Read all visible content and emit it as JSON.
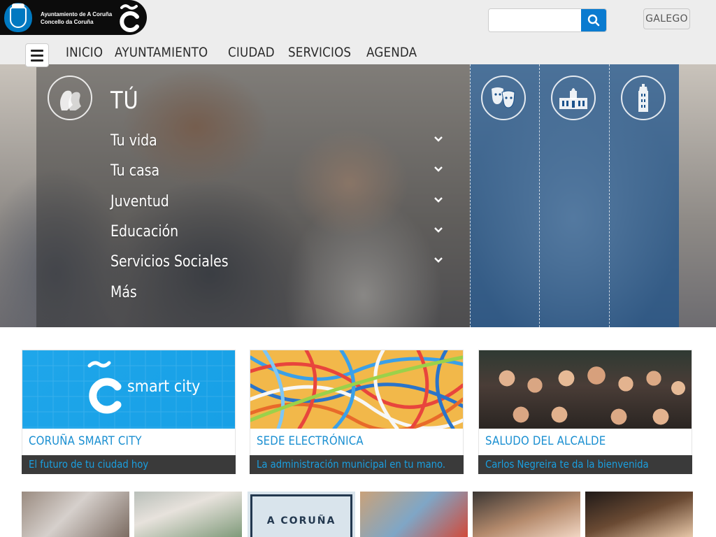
{
  "header": {
    "logo_line1": "Ayuntamiento de A Coruña",
    "logo_line2": "Concello da Coruña",
    "search_placeholder": "",
    "language_button": "GALEGO"
  },
  "nav": {
    "items": [
      "INICIO",
      "AYUNTAMIENTO",
      "CIUDAD",
      "SERVICIOS",
      "AGENDA"
    ]
  },
  "hero": {
    "title": "TÚ",
    "items": [
      {
        "label": "Tu vida",
        "expandable": true
      },
      {
        "label": "Tu casa",
        "expandable": true
      },
      {
        "label": "Juventud",
        "expandable": true
      },
      {
        "label": "Educación",
        "expandable": true
      },
      {
        "label": "Servicios Sociales",
        "expandable": true
      },
      {
        "label": "Más",
        "expandable": false
      }
    ],
    "right_icons": [
      "theater-masks-icon",
      "city-hall-icon",
      "tower-icon"
    ]
  },
  "cards": [
    {
      "title": "CORUÑA SMART CITY",
      "subtitle": "El futuro de tu ciudad hoy",
      "image_text": "smart city"
    },
    {
      "title": "SEDE ELECTRÓNICA",
      "subtitle": "La administración municipal en tu mano."
    },
    {
      "title": "SALUDO DEL ALCALDE",
      "subtitle": "Carlos Negreira te da la bienvenida"
    }
  ],
  "bottom_thumbs": {
    "thumb3_text": "A CORUÑA"
  },
  "colors": {
    "accent": "#1a8fd1",
    "search_button": "#0a7bd0",
    "header_bg": "#ededed",
    "overlay_blue": "#1a528c",
    "card_sub_bg": "#3a3a3a"
  }
}
